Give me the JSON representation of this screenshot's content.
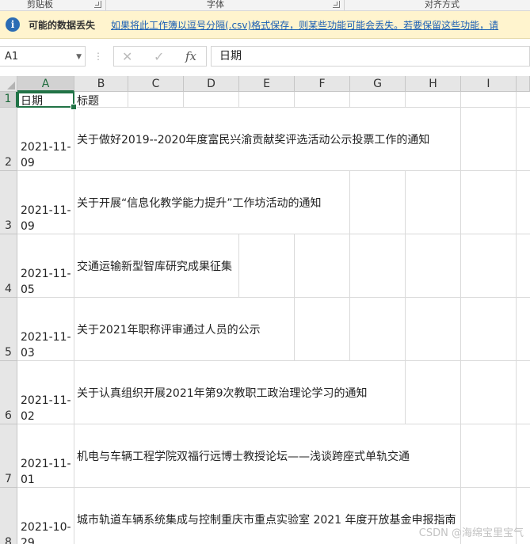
{
  "ribbon": {
    "groups": [
      "剪贴板",
      "字体",
      "对齐方式"
    ]
  },
  "message_bar": {
    "title": "可能的数据丢失",
    "text": "如果将此工作簿以逗号分隔(.csv)格式保存，则某些功能可能会丢失。若要保留这些功能，请"
  },
  "formula_bar": {
    "name_box": "A1",
    "fx_symbol": "fx",
    "content": "日期"
  },
  "sheet": {
    "columns": [
      "A",
      "B",
      "C",
      "D",
      "E",
      "F",
      "G",
      "H",
      "I"
    ],
    "rows": [
      {
        "num": "1",
        "date": "日期",
        "title": "标题"
      },
      {
        "num": "2",
        "date": "2021-11-09",
        "title": "关于做好2019--2020年度富民兴渝贡献奖评选活动公示投票工作的通知"
      },
      {
        "num": "3",
        "date": "2021-11-09",
        "title": "关于开展“信息化教学能力提升”工作坊活动的通知"
      },
      {
        "num": "4",
        "date": "2021-11-05",
        "title": "交通运输新型智库研究成果征集"
      },
      {
        "num": "5",
        "date": "2021-11-03",
        "title": "关于2021年职称评审通过人员的公示"
      },
      {
        "num": "6",
        "date": "2021-11-02",
        "title": "关于认真组织开展2021年第9次教职工政治理论学习的通知"
      },
      {
        "num": "7",
        "date": "2021-11-01",
        "title": "机电与车辆工程学院双福行远博士教授论坛——浅谈跨座式单轨交通"
      },
      {
        "num": "8",
        "date": "2021-10-29",
        "title": "城市轨道车辆系统集成与控制重庆市重点实验室 2021 年度开放基金申报指南"
      }
    ]
  },
  "watermark": "CSDN @海绵宝里宝气",
  "colors": {
    "accent": "#217346",
    "message_bar_bg": "#fff4ce",
    "link": "#1a5fb4"
  }
}
